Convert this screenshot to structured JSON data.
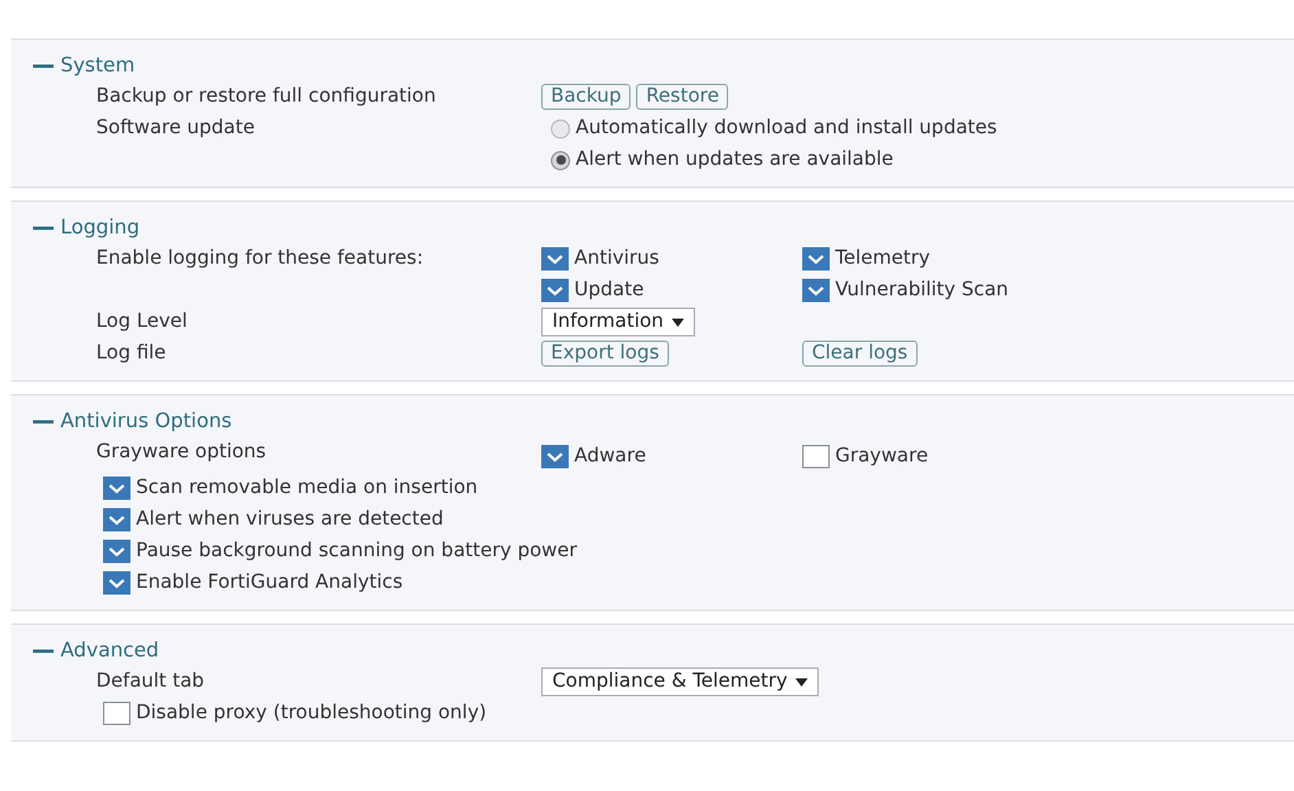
{
  "sections": [
    {
      "title": "System",
      "expanded": true,
      "rows": [
        {
          "kind": "buttons",
          "label": "Backup or restore full configuration",
          "buttons": [
            "Backup",
            "Restore"
          ]
        },
        {
          "kind": "radios",
          "label": "Software update",
          "options": [
            {
              "label": "Automatically download and install updates",
              "selected": false
            },
            {
              "label": "Alert when updates are available",
              "selected": true
            }
          ]
        }
      ]
    },
    {
      "title": "Logging",
      "expanded": true,
      "rows": [
        {
          "kind": "checks",
          "label": "Enable logging for these features:",
          "options": [
            {
              "label": "Antivirus",
              "checked": true
            },
            {
              "label": "Telemetry",
              "checked": true
            },
            {
              "label": "Update",
              "checked": true
            },
            {
              "label": "Vulnerability Scan",
              "checked": true
            }
          ]
        },
        {
          "kind": "select",
          "label": "Log Level",
          "value": "Information"
        },
        {
          "kind": "button-grid",
          "label": "Log file",
          "buttons": [
            "Export logs",
            "Clear logs"
          ]
        }
      ]
    },
    {
      "title": "Antivirus Options",
      "expanded": true,
      "rows": [
        {
          "kind": "checks",
          "label": "Grayware options",
          "options": [
            {
              "label": "Adware",
              "checked": true
            },
            {
              "label": "Grayware",
              "checked": false
            }
          ]
        },
        {
          "kind": "checkbox",
          "label": "Scan removable media on insertion",
          "checked": true
        },
        {
          "kind": "checkbox",
          "label": "Alert when viruses are detected",
          "checked": true
        },
        {
          "kind": "checkbox",
          "label": "Pause background scanning on battery power",
          "checked": true
        },
        {
          "kind": "checkbox",
          "label": "Enable FortiGuard Analytics",
          "checked": true
        }
      ]
    },
    {
      "title": "Advanced",
      "expanded": true,
      "rows": [
        {
          "kind": "select",
          "label": "Default tab",
          "value": "Compliance & Telemetry"
        },
        {
          "kind": "checkbox",
          "label": "Disable proxy (troubleshooting only)",
          "checked": false
        }
      ]
    }
  ]
}
